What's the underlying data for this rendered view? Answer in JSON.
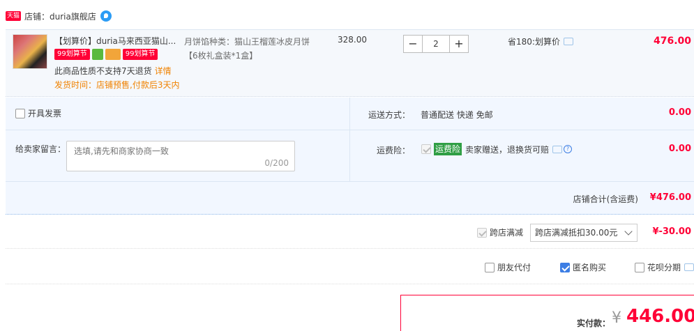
{
  "shop": {
    "badge": "天猫",
    "name": "店铺：duria旗舰店"
  },
  "item": {
    "title": "【划算价】duria马来西亚猫山...",
    "tags": [
      "99划算节",
      "99划算节"
    ],
    "return_notice": "此商品性质不支持7天退货",
    "detail_link": "详情",
    "ship_time": "发货时间：店铺预售,付款后3天内",
    "attr_line1": "月饼馅种类：猫山王榴莲冰皮月饼",
    "attr_line2": "【6枚礼盒装*1盒】",
    "unit_price": "328.00",
    "qty_minus": "−",
    "qty_value": "2",
    "qty_plus": "+",
    "save_text": "省180:划算价",
    "total": "476.00"
  },
  "invoice": {
    "label": "开具发票"
  },
  "message": {
    "label": "给卖家留言：",
    "placeholder": "选填,请先和商家协商一致",
    "count": "0/200"
  },
  "shipping": {
    "label": "运送方式：",
    "value": "普通配送 快递 免邮",
    "price": "0.00"
  },
  "insurance": {
    "label": "运费险：",
    "tag": "运费险",
    "text": "卖家赠送，退换货可赔",
    "help": "?",
    "price": "0.00"
  },
  "shop_total": {
    "label": "店铺合计(含运费)",
    "value": "¥476.00"
  },
  "discount": {
    "label": "跨店满减",
    "select": "跨店满减抵扣30.00元",
    "value": "¥-30.00"
  },
  "options": {
    "friend_pay": "朋友代付",
    "anonymous": "匿名购买",
    "huabei": "花呗分期"
  },
  "payment": {
    "label": "实付款：",
    "currency": "¥",
    "amount": "446.00"
  },
  "colors": {
    "accent": "#ff0036",
    "blue_bg": "#f2f7ff",
    "orange": "#f08200"
  }
}
